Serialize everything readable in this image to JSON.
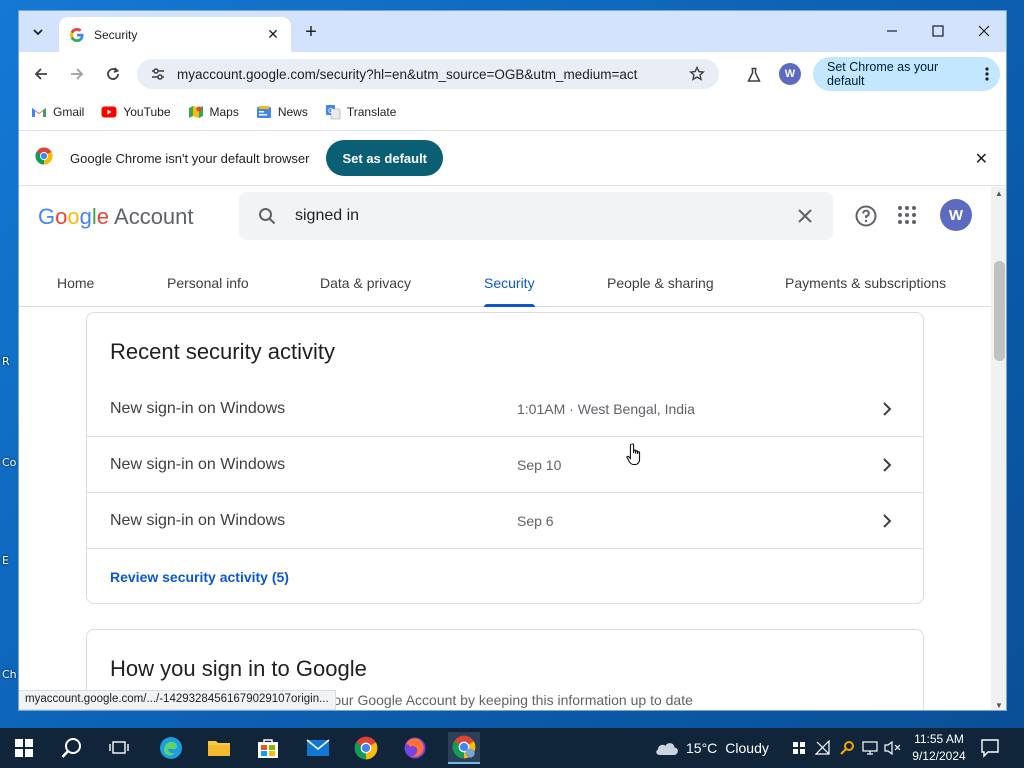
{
  "desktop": {
    "fragments": [
      "R",
      "Co",
      "E",
      "Ch"
    ]
  },
  "browser": {
    "tab": {
      "title": "Security",
      "favicon": "google-g-icon"
    },
    "url": "myaccount.google.com/security?hl=en&utm_source=OGB&utm_medium=act",
    "profile_initial": "W",
    "set_default_pill": "Set Chrome as your default",
    "bookmarks": [
      {
        "label": "Gmail",
        "icon": "gmail-icon"
      },
      {
        "label": "YouTube",
        "icon": "youtube-icon"
      },
      {
        "label": "Maps",
        "icon": "maps-icon"
      },
      {
        "label": "News",
        "icon": "news-icon"
      },
      {
        "label": "Translate",
        "icon": "translate-icon"
      }
    ],
    "infobar": {
      "message": "Google Chrome isn't your default browser",
      "button": "Set as default"
    },
    "status_url": "myaccount.google.com/.../-14293284561679029107origin..."
  },
  "account": {
    "logo_google": [
      "G",
      "o",
      "o",
      "g",
      "l",
      "e"
    ],
    "logo_account": "Account",
    "search_value": "signed in",
    "avatar_initial": "W",
    "nav_tabs": [
      "Home",
      "Personal info",
      "Data & privacy",
      "Security",
      "People & sharing",
      "Payments & subscriptions"
    ],
    "active_tab": "Security",
    "recent_activity": {
      "title": "Recent security activity",
      "rows": [
        {
          "label": "New sign-in on Windows",
          "meta": "1:01AM · West Bengal, India"
        },
        {
          "label": "New sign-in on Windows",
          "meta": "Sep 10"
        },
        {
          "label": "New sign-in on Windows",
          "meta": "Sep 6"
        }
      ],
      "review_link": "Review security activity (5)"
    },
    "sign_in_card": {
      "title": "How you sign in to Google",
      "description": "Make sure you can always access your Google Account by keeping this information up to date"
    }
  },
  "taskbar": {
    "weather": {
      "temp": "15°C",
      "condition": "Cloudy"
    },
    "clock": {
      "time": "11:55 AM",
      "date": "9/12/2024"
    }
  },
  "colors": {
    "accent_blue": "#0b57d0",
    "infobar_button": "#0b5f75",
    "pill_bg": "#c2e7ff",
    "tab_strip": "#d3e3fd",
    "avatar": "#5c6bc0",
    "taskbar": "#10243a"
  }
}
